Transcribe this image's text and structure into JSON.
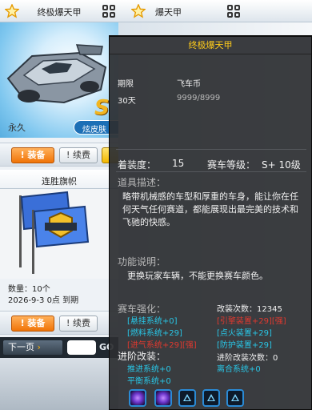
{
  "left_card": {
    "title": "终极爆天甲",
    "duration": "永久",
    "skin_badge": "炫皮肤",
    "equip_label": "装备",
    "renew_label": "续费"
  },
  "second_card": {
    "title": "连胜旗帜",
    "qty": "数量：10个",
    "expiry": "2026-9-3 0点 到期",
    "equip_label": "装备",
    "renew_label": "续费"
  },
  "pager": {
    "next_label": "下一页",
    "go_label": "GO"
  },
  "right_card": {
    "title": "爆天甲"
  },
  "tooltip": {
    "title": "终极爆天甲",
    "period_header": "期限",
    "currency_header": "飞车币",
    "period_value": "30天",
    "currency_value": "9999/8999",
    "equip_level_label": "着装度：",
    "equip_level_value": "15",
    "class_label": "赛车等级：",
    "class_value": "S+ 10级",
    "desc_header": "道具描述：",
    "description": "略带机械感的车型和厚重的车身，能让你在任何天气任何赛道，都能展现出最完美的技术和飞驰的快感。",
    "func_header": "功能说明：",
    "func_text": "更换玩家车辆，不能更换赛车颜色。",
    "enhance_header": "赛车强化：",
    "mod_count": "改装次数：12345",
    "enhancements": [
      {
        "text": "[悬挂系统+0]",
        "color": "#29c6e6"
      },
      {
        "text": "[引擎装置+29][强]",
        "color": "#e0392f"
      },
      {
        "text": "[燃料系统+29]",
        "color": "#29c6e6"
      },
      {
        "text": "[点火装置+29]",
        "color": "#29c6e6"
      },
      {
        "text": "[进气系统+29][强]",
        "color": "#e0392f"
      },
      {
        "text": "[防护装置+29]",
        "color": "#29c6e6"
      }
    ],
    "advanced_header": "进阶改装：",
    "advanced_count": "进阶改装次数：0",
    "advanced_items": [
      "推进系统+0",
      "离合系统+0",
      "平衡系统+0"
    ],
    "slot_icons": [
      "purple-gem-icon",
      "purple-gem-icon",
      "triangle-icon",
      "triangle-icon",
      "triangle-icon"
    ]
  },
  "colors": {
    "title_yellow": "#ffcc1a",
    "equip_orange": "#f07408",
    "blue_text": "#29c6e6",
    "red_text": "#e0392f"
  }
}
